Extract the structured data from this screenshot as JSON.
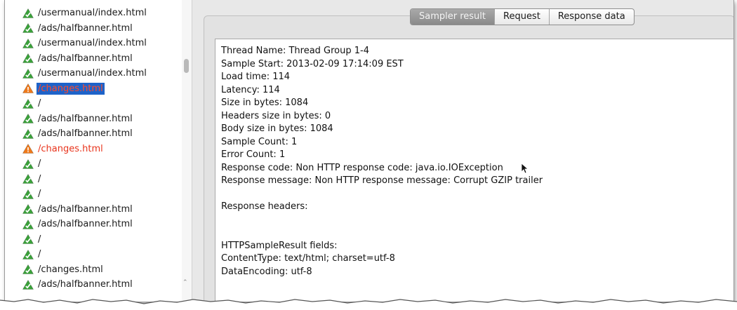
{
  "tree": {
    "items": [
      {
        "label": "/usermanual/index.html",
        "status": "ok"
      },
      {
        "label": "/ads/halfbanner.html",
        "status": "ok"
      },
      {
        "label": "/usermanual/index.html",
        "status": "ok"
      },
      {
        "label": "/ads/halfbanner.html",
        "status": "ok"
      },
      {
        "label": "/usermanual/index.html",
        "status": "ok"
      },
      {
        "label": "/changes.html",
        "status": "error",
        "selected": true
      },
      {
        "label": "/",
        "status": "ok"
      },
      {
        "label": "/ads/halfbanner.html",
        "status": "ok"
      },
      {
        "label": "/ads/halfbanner.html",
        "status": "ok"
      },
      {
        "label": "/changes.html",
        "status": "error"
      },
      {
        "label": "/",
        "status": "ok"
      },
      {
        "label": "/",
        "status": "ok"
      },
      {
        "label": "/",
        "status": "ok"
      },
      {
        "label": "/ads/halfbanner.html",
        "status": "ok"
      },
      {
        "label": "/ads/halfbanner.html",
        "status": "ok"
      },
      {
        "label": "/",
        "status": "ok"
      },
      {
        "label": "/",
        "status": "ok"
      },
      {
        "label": "/changes.html",
        "status": "ok"
      },
      {
        "label": "/ads/halfbanner.html",
        "status": "ok"
      }
    ]
  },
  "tabs": {
    "sampler_result": "Sampler result",
    "request": "Request",
    "response_data": "Response data",
    "active": "sampler_result"
  },
  "result": {
    "lines": [
      "Thread Name: Thread Group 1-4",
      "Sample Start: 2013-02-09 17:14:09 EST",
      "Load time: 114",
      "Latency: 114",
      "Size in bytes: 1084",
      "Headers size in bytes: 0",
      "Body size in bytes: 1084",
      "Sample Count: 1",
      "Error Count: 1",
      "Response code: Non HTTP response code: java.io.IOException",
      "Response message: Non HTTP response message: Corrupt GZIP trailer",
      "",
      "Response headers:",
      "",
      "",
      "HTTPSampleResult fields:",
      "ContentType: text/html; charset=utf-8",
      "DataEncoding: utf-8"
    ]
  },
  "colors": {
    "ok_icon": "#3aa23a",
    "error_icon": "#f07a1a",
    "error_text": "#e8341c",
    "selection": "#1e63c9"
  },
  "icons": {
    "ok": "success-triangle-icon",
    "error": "warning-triangle-icon",
    "pointer": "mouse-pointer-icon"
  }
}
